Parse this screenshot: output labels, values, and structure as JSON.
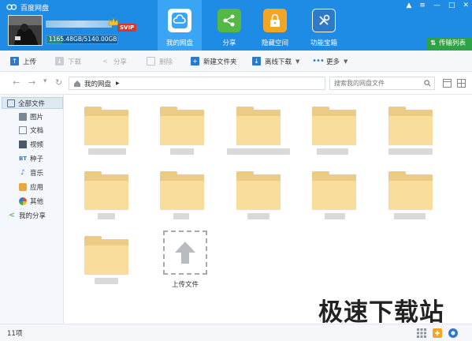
{
  "app": {
    "title": "百度网盘"
  },
  "account": {
    "plan": "SVIP",
    "quota_used": "1165.48GB",
    "quota_total": "5140.00GB",
    "quota_text": "1165.48GB/5140.00GB",
    "quota_fraction": 0.227
  },
  "nav_tabs": [
    {
      "label": "我的网盘",
      "icon": "cloud-icon",
      "active": true,
      "color": "#3ba5f5"
    },
    {
      "label": "分享",
      "icon": "share-icon",
      "active": false,
      "color": "#55b845"
    },
    {
      "label": "隐藏空间",
      "icon": "lock-icon",
      "active": false,
      "color": "#f3a623"
    },
    {
      "label": "功能宝箱",
      "icon": "toolbox-icon",
      "active": false,
      "color": "#2f7ac8"
    }
  ],
  "transfer_list": {
    "label": "传输列表"
  },
  "toolbar": {
    "upload": "上传",
    "download": "下载",
    "share": "分享",
    "delete": "删除",
    "new_folder": "新建文件夹",
    "offline_download": "离线下载",
    "more": "更多"
  },
  "address": {
    "path": "我的网盘",
    "search_placeholder": "搜索我的网盘文件"
  },
  "sidebar": {
    "items": [
      {
        "label": "全部文件",
        "icon": "all-files-icon",
        "selected": true
      },
      {
        "label": "图片",
        "icon": "image-icon",
        "selected": false
      },
      {
        "label": "文档",
        "icon": "document-icon",
        "selected": false
      },
      {
        "label": "视频",
        "icon": "video-icon",
        "selected": false
      },
      {
        "label": "种子",
        "icon": "bt-icon",
        "selected": false
      },
      {
        "label": "音乐",
        "icon": "music-icon",
        "selected": false
      },
      {
        "label": "应用",
        "icon": "app-icon",
        "selected": false
      },
      {
        "label": "其他",
        "icon": "other-icon",
        "selected": false
      },
      {
        "label": "我的分享",
        "icon": "share-icon",
        "selected": false
      }
    ]
  },
  "upload_tile": {
    "label": "上传文件"
  },
  "status": {
    "count": "11项"
  },
  "watermark": "极速下载站"
}
